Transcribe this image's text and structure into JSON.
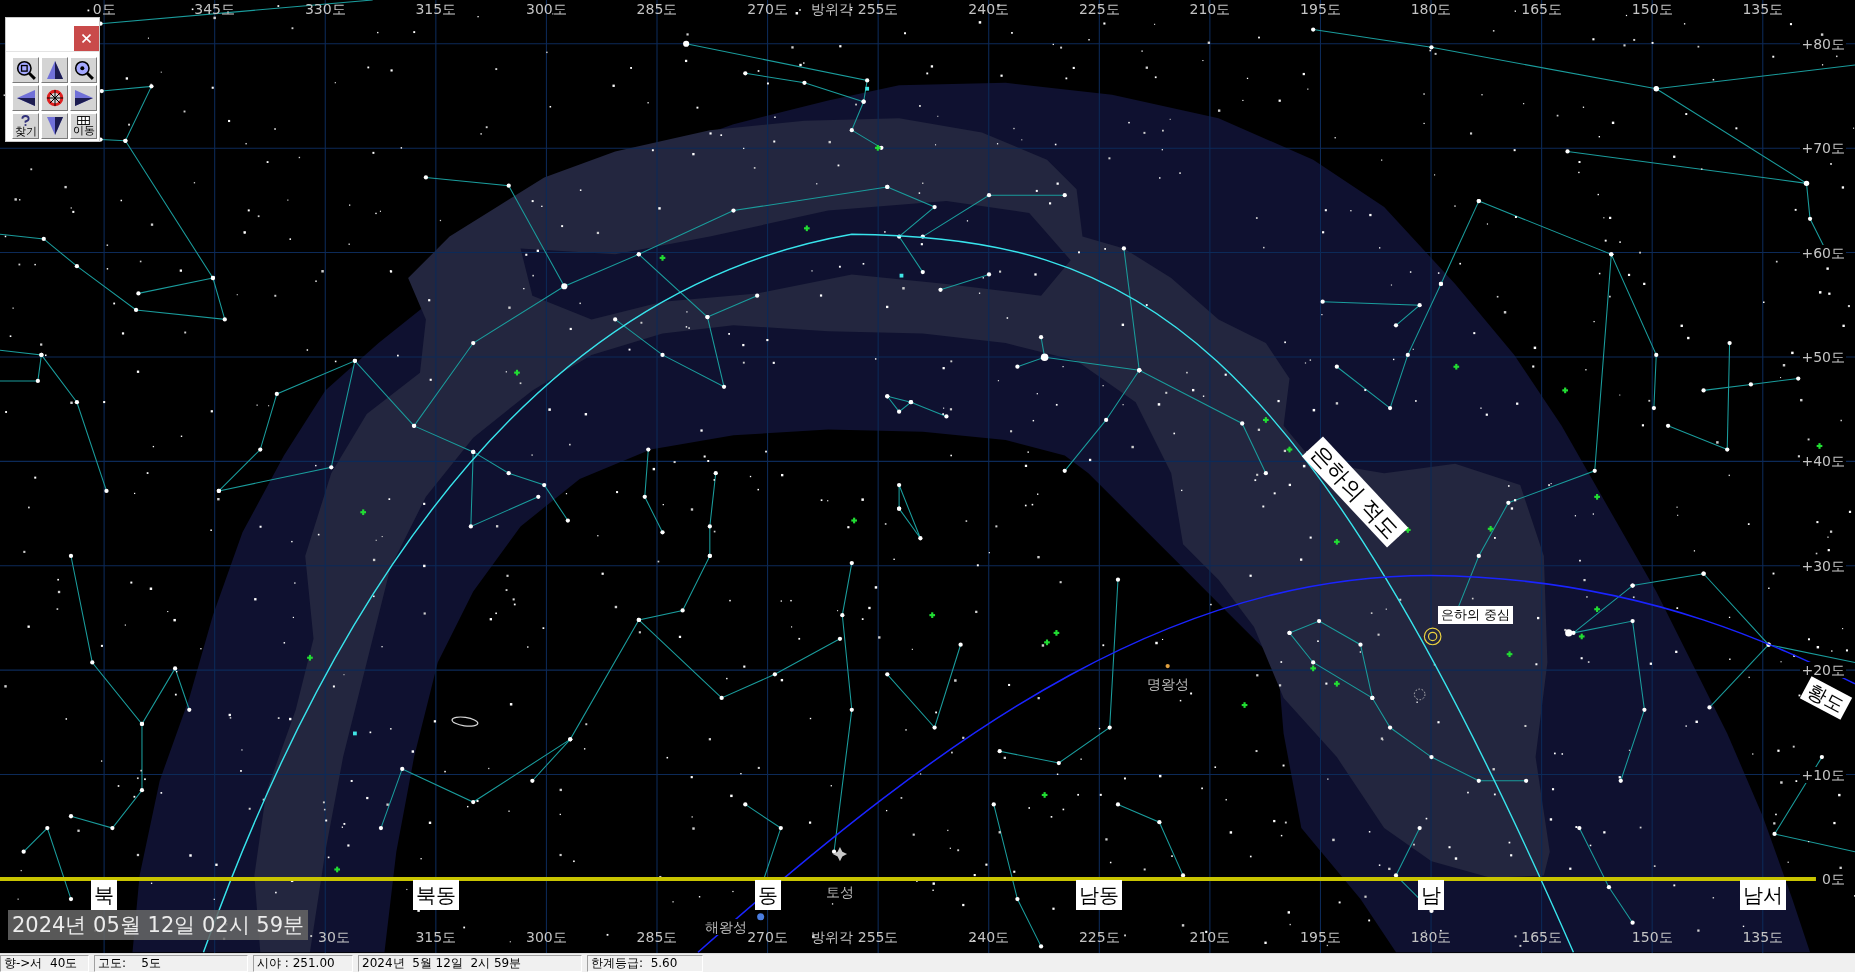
{
  "nav_panel": {
    "find_label": "찾기",
    "move_label": "이동"
  },
  "azimuth_top": [
    {
      "label": "0도"
    },
    {
      "label": "345도"
    },
    {
      "label": "330도"
    },
    {
      "label": "315도"
    },
    {
      "label": "300도"
    },
    {
      "label": "285도"
    },
    {
      "label": "270도"
    },
    {
      "prefix": "방위각",
      "label": "255도"
    },
    {
      "label": "240도"
    },
    {
      "label": "225도"
    },
    {
      "label": "210도"
    },
    {
      "label": "195도"
    },
    {
      "label": "180도"
    },
    {
      "label": "165도"
    },
    {
      "label": "150도"
    },
    {
      "label": "135도"
    }
  ],
  "altitude_right": [
    "+80도",
    "+70도",
    "+60도",
    "+50도",
    "+40도",
    "+30도",
    "+20도",
    "+10도",
    "0도"
  ],
  "sky_labels": [
    {
      "kind": "rotated",
      "text": "은하의 적도"
    },
    {
      "kind": "boxed",
      "text": "은하의 중심"
    },
    {
      "kind": "rotated",
      "text": "황도"
    },
    {
      "kind": "plain",
      "text": "명왕성"
    },
    {
      "kind": "plain",
      "text": "토성"
    },
    {
      "kind": "plain",
      "text": "해왕성"
    }
  ],
  "horizon_directions": [
    "북",
    "북동",
    "동",
    "남동",
    "남",
    "남서"
  ],
  "azimuth_bottom": [
    {
      "label": "30도"
    },
    {
      "label": "315도"
    },
    {
      "label": "300도"
    },
    {
      "label": "285도"
    },
    {
      "label": "270도"
    },
    {
      "prefix": "방위각",
      "label": "255도"
    },
    {
      "label": "240도"
    },
    {
      "label": "225도"
    },
    {
      "label": "210도"
    },
    {
      "label": "195도"
    },
    {
      "label": "180도"
    },
    {
      "label": "165도"
    },
    {
      "label": "150도"
    },
    {
      "label": "135도"
    }
  ],
  "date_overlay": "2024년 05월 12일 02시 59분",
  "status_bar": [
    "향->서  40도",
    "고도:    5도",
    "시야 : 251.00",
    "2024년  5월 12일  2시 59분",
    "한계등급:  5.60"
  ]
}
